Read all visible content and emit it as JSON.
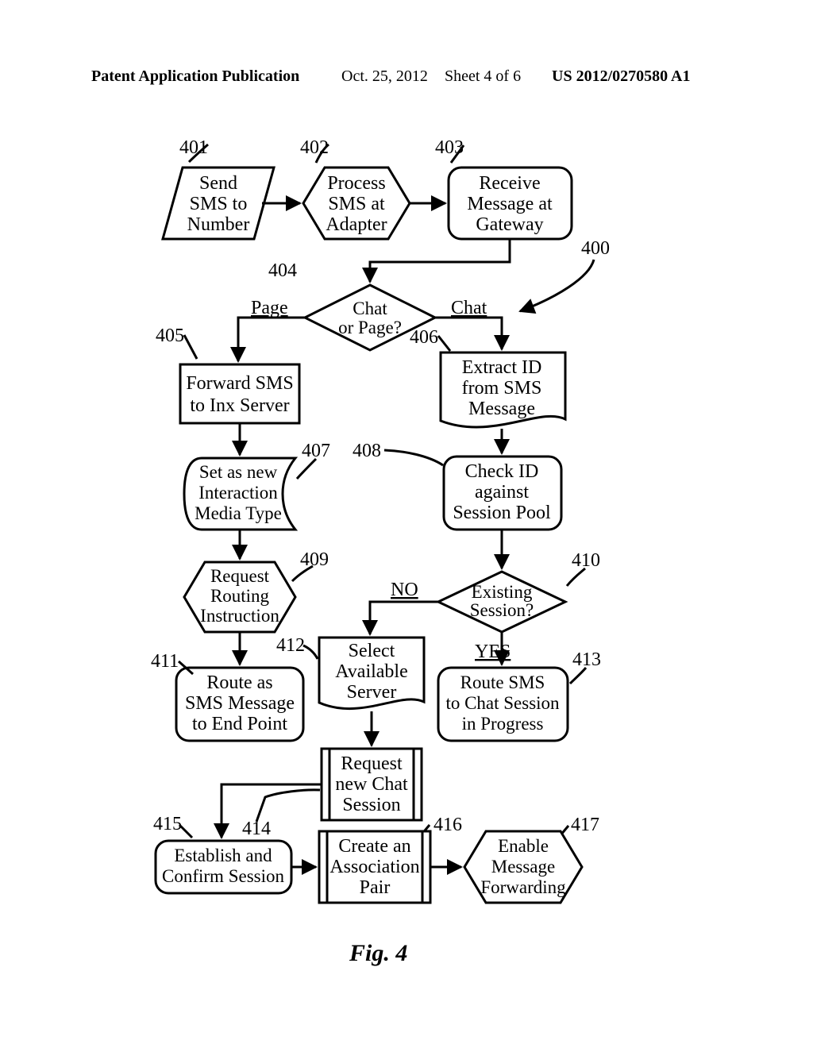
{
  "header": {
    "left": "Patent Application Publication",
    "date": "Oct. 25, 2012",
    "sheet": "Sheet 4 of 6",
    "pubno": "US 2012/0270580 A1"
  },
  "figure_label": "Fig. 4",
  "refs": {
    "r400": "400",
    "r401": "401",
    "r402": "402",
    "r403": "403",
    "r404": "404",
    "r405": "405",
    "r406": "406",
    "r407": "407",
    "r408": "408",
    "r409": "409",
    "r410": "410",
    "r411": "411",
    "r412": "412",
    "r413": "413",
    "r414": "414",
    "r415": "415",
    "r416": "416",
    "r417": "417"
  },
  "nodes": {
    "n401": {
      "l1": "Send",
      "l2": "SMS to",
      "l3": "Number"
    },
    "n402": {
      "l1": "Process",
      "l2": "SMS at",
      "l3": "Adapter"
    },
    "n403": {
      "l1": "Receive",
      "l2": "Message at",
      "l3": "Gateway"
    },
    "n404": {
      "l1": "Chat",
      "l2": "or Page?"
    },
    "n405": {
      "l1": "Forward SMS",
      "l2": "to Inx Server"
    },
    "n406": {
      "l1": "Extract ID",
      "l2": "from SMS",
      "l3": "Message"
    },
    "n407": {
      "l1": "Set as new",
      "l2": "Interaction",
      "l3": "Media Type"
    },
    "n408": {
      "l1": "Check ID",
      "l2": "against",
      "l3": "Session Pool"
    },
    "n409": {
      "l1": "Request",
      "l2": "Routing",
      "l3": "Instruction"
    },
    "n410": {
      "l1": "Existing",
      "l2": "Session?"
    },
    "n411": {
      "l1": "Route as",
      "l2": "SMS Message",
      "l3": "to End Point"
    },
    "n412": {
      "l1": "Select",
      "l2": "Available",
      "l3": "Server"
    },
    "n413": {
      "l1": "Route SMS",
      "l2": "to Chat Session",
      "l3": "in Progress"
    },
    "n414": {
      "l1": "Request",
      "l2": "new Chat",
      "l3": "Session"
    },
    "n415": {
      "l1": "Establish and",
      "l2": "Confirm Session"
    },
    "n416": {
      "l1": "Create an",
      "l2": "Association",
      "l3": "Pair"
    },
    "n417": {
      "l1": "Enable",
      "l2": "Message",
      "l3": "Forwarding"
    }
  },
  "edges": {
    "page": "Page",
    "chat": "Chat",
    "yes": "YES",
    "no": "NO"
  }
}
